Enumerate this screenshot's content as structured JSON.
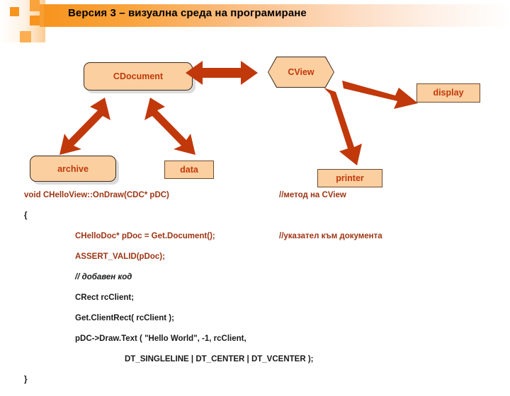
{
  "slide": {
    "title": "Версия 3 – визуална среда на програмиране",
    "accent_color": "#C0390B",
    "banner_color": "#F7941E",
    "box_fill": "#FBCFA0",
    "code_red": "#9C3412"
  },
  "diagram": {
    "nodes": [
      {
        "id": "cdocument",
        "label": "CDocument",
        "shape": "rounded-rect"
      },
      {
        "id": "cview",
        "label": "CView",
        "shape": "hexagon"
      },
      {
        "id": "display",
        "label": "display",
        "shape": "rect"
      },
      {
        "id": "archive",
        "label": "archive",
        "shape": "rounded-rect"
      },
      {
        "id": "data",
        "label": "data",
        "shape": "rect"
      },
      {
        "id": "printer",
        "label": "printer",
        "shape": "rect"
      }
    ],
    "edges": [
      {
        "from": "cdocument",
        "to": "cview",
        "type": "double"
      },
      {
        "from": "cdocument",
        "to": "archive",
        "type": "double"
      },
      {
        "from": "cdocument",
        "to": "data",
        "type": "double"
      },
      {
        "from": "cview",
        "to": "display",
        "type": "single"
      },
      {
        "from": "cview",
        "to": "printer",
        "type": "single"
      }
    ]
  },
  "code": {
    "lines": [
      {
        "indent": 0,
        "text": "void CHelloView::OnDraw(CDC* pDC)",
        "style": "red",
        "comment": "//метод на CView"
      },
      {
        "indent": 0,
        "text": "{",
        "style": "dark",
        "comment": ""
      },
      {
        "indent": 1,
        "text": "CHelloDoc* pDoc = Get.Document();",
        "style": "red",
        "comment": "//указател към документа"
      },
      {
        "indent": 1,
        "text": "ASSERT_VALID(pDoc);",
        "style": "red",
        "comment": ""
      },
      {
        "indent": 1,
        "text": "// добавен код",
        "style": "italic",
        "comment": ""
      },
      {
        "indent": 1,
        "text": "CRect rcClient;",
        "style": "dark",
        "comment": ""
      },
      {
        "indent": 1,
        "text": "Get.ClientRect( rcClient );",
        "style": "dark",
        "comment": ""
      },
      {
        "indent": 1,
        "text": "pDC->Draw.Text ( \"Hello World\", -1, rcClient,",
        "style": "dark",
        "comment": ""
      },
      {
        "indent": 2,
        "text": "DT_SINGLELINE | DT_CENTER | DT_VCENTER );",
        "style": "dark",
        "comment": ""
      },
      {
        "indent": 0,
        "text": "}",
        "style": "dark",
        "comment": ""
      }
    ]
  }
}
